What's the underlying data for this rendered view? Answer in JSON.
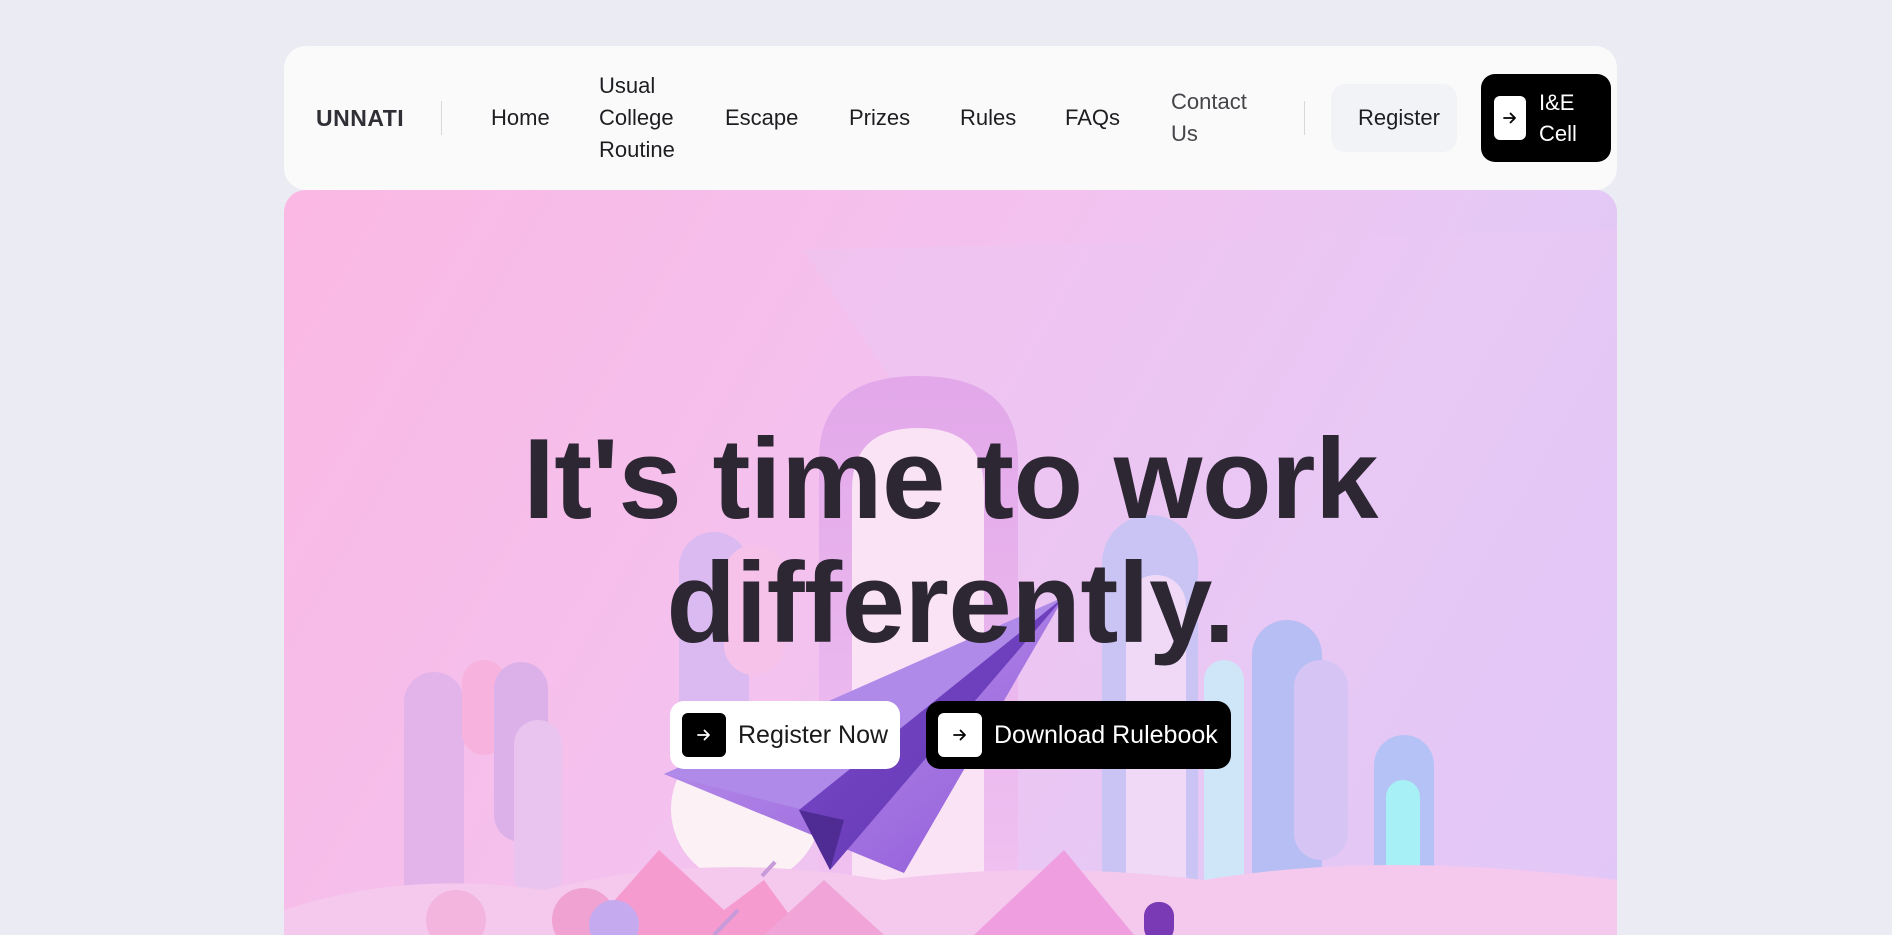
{
  "brand": {
    "logo_text": "UNNATI"
  },
  "nav": {
    "links": [
      {
        "label": "Home"
      },
      {
        "label": "Usual College Routine"
      },
      {
        "label": "Escape"
      },
      {
        "label": "Prizes"
      },
      {
        "label": "Rules"
      },
      {
        "label": "FAQs"
      },
      {
        "label": "Contact Us"
      }
    ],
    "register_label": "Register",
    "ie_cell_label": "I&E Cell"
  },
  "hero": {
    "headline_line1": "It's time to work",
    "headline_line2": "differently.",
    "primary_cta": "Register Now",
    "secondary_cta": "Download Rulebook"
  },
  "icons": {
    "arrow": "arrow-right-icon"
  },
  "colors": {
    "page_bg": "#ebebf3",
    "nav_bg": "#fafafa",
    "accent_dark": "#000000",
    "headline": "#2d2633",
    "hero_pink": "#fbb8e4",
    "hero_lavender": "#d8c6fa"
  }
}
